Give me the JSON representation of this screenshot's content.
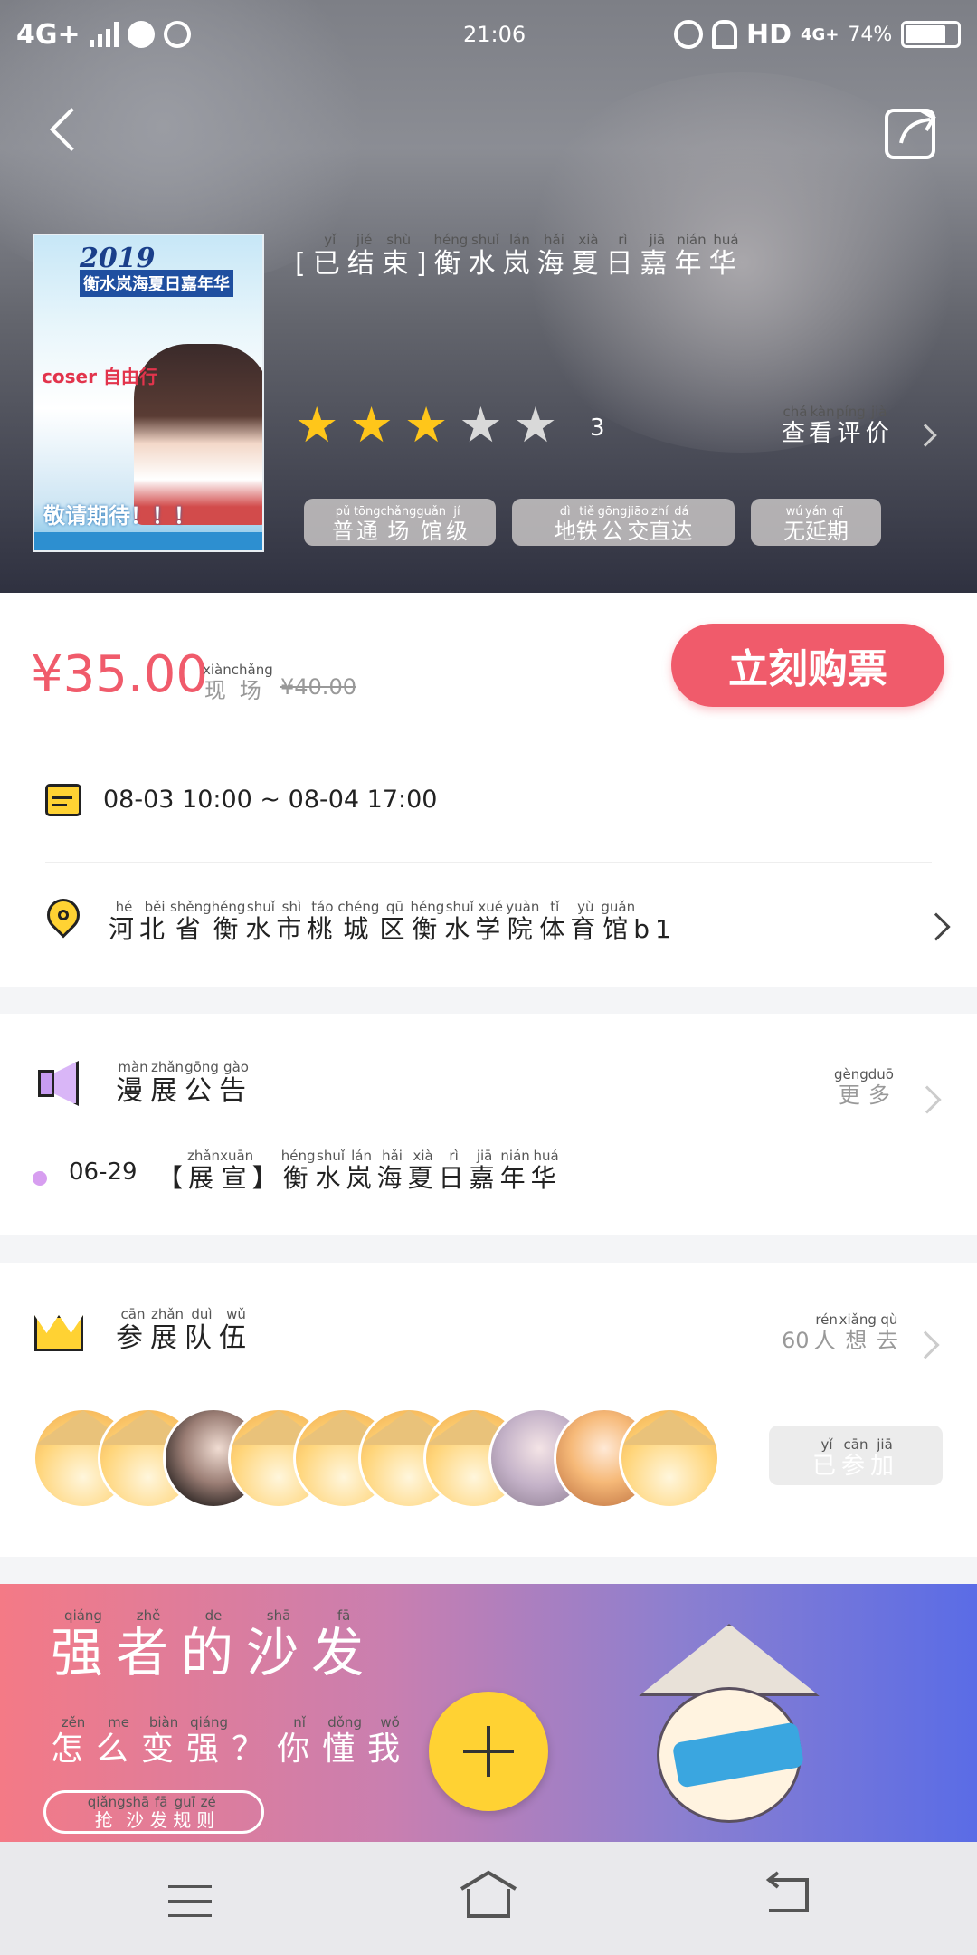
{
  "status_bar": {
    "network": "4G+",
    "time": "21:06",
    "hd": "HD",
    "network2": "4G+",
    "battery": "74%"
  },
  "event": {
    "title_prefix": "[已结束]",
    "title_chars": [
      {
        "c": "已",
        "p": "yǐ"
      },
      {
        "c": "结",
        "p": "jié"
      },
      {
        "c": "束",
        "p": "shù"
      },
      {
        "c": "衡",
        "p": "héng"
      },
      {
        "c": "水",
        "p": "shuǐ"
      },
      {
        "c": "岚",
        "p": "lán"
      },
      {
        "c": "海",
        "p": "hǎi"
      },
      {
        "c": "夏",
        "p": "xià"
      },
      {
        "c": "日",
        "p": "rì"
      },
      {
        "c": "嘉",
        "p": "jiā"
      },
      {
        "c": "年",
        "p": "nián"
      },
      {
        "c": "华",
        "p": "huá"
      }
    ],
    "rating_value": 3,
    "rating_max": 5,
    "rating_text": "3",
    "reviews_link": {
      "chars": [
        {
          "c": "查",
          "p": "chá"
        },
        {
          "c": "看",
          "p": "kàn"
        },
        {
          "c": "评",
          "p": "píng"
        },
        {
          "c": "价",
          "p": "jià"
        }
      ]
    },
    "tags": [
      {
        "chars": [
          {
            "c": "普",
            "p": "pǔ"
          },
          {
            "c": "通",
            "p": "tōng"
          },
          {
            "c": "场",
            "p": "chǎng"
          },
          {
            "c": "馆",
            "p": "guǎn"
          },
          {
            "c": "级",
            "p": "jí"
          }
        ]
      },
      {
        "chars": [
          {
            "c": "地",
            "p": "dì"
          },
          {
            "c": "铁",
            "p": "tiě"
          },
          {
            "c": "公",
            "p": "gōng"
          },
          {
            "c": "交",
            "p": "jiāo"
          },
          {
            "c": "直",
            "p": "zhí"
          },
          {
            "c": "达",
            "p": "dá"
          }
        ]
      },
      {
        "chars": [
          {
            "c": "无",
            "p": "wú"
          },
          {
            "c": "延",
            "p": "yán"
          },
          {
            "c": "期",
            "p": "qī"
          }
        ]
      }
    ],
    "poster": {
      "year": "2019",
      "title": "衡水岚海夏日嘉年华",
      "cos": "coser 自由行",
      "bottom": "敬请期待！！！"
    }
  },
  "pricing": {
    "price": "¥35.00",
    "label_chars": [
      {
        "c": "现",
        "p": "xiàn"
      },
      {
        "c": "场",
        "p": "chǎng"
      }
    ],
    "original_price": "¥40.00",
    "buy_label": "立刻购票",
    "accent": "#f05b6b"
  },
  "schedule": {
    "datetime": "08-03 10:00 ~ 08-04 17:00"
  },
  "location": {
    "chars": [
      {
        "c": "河",
        "p": "hé"
      },
      {
        "c": "北",
        "p": "běi"
      },
      {
        "c": "省",
        "p": "shěng"
      },
      {
        "c": "衡",
        "p": "héng"
      },
      {
        "c": "水",
        "p": "shuǐ"
      },
      {
        "c": "市",
        "p": "shì"
      },
      {
        "c": "桃",
        "p": "táo"
      },
      {
        "c": "城",
        "p": "chéng"
      },
      {
        "c": "区",
        "p": "qū"
      },
      {
        "c": "衡",
        "p": "héng"
      },
      {
        "c": "水",
        "p": "shuǐ"
      },
      {
        "c": "学",
        "p": "xué"
      },
      {
        "c": "院",
        "p": "yuàn"
      },
      {
        "c": "体",
        "p": "tǐ"
      },
      {
        "c": "育",
        "p": "yù"
      },
      {
        "c": "馆",
        "p": "guǎn"
      }
    ],
    "suffix": "b1"
  },
  "announcements": {
    "title_chars": [
      {
        "c": "漫",
        "p": "màn"
      },
      {
        "c": "展",
        "p": "zhǎn"
      },
      {
        "c": "公",
        "p": "gōng"
      },
      {
        "c": "告",
        "p": "gào"
      }
    ],
    "more_chars": [
      {
        "c": "更",
        "p": "gèng"
      },
      {
        "c": "多",
        "p": "duō"
      }
    ],
    "item": {
      "date": "06-29",
      "bracket_chars": [
        {
          "c": "展",
          "p": "zhǎn"
        },
        {
          "c": "宣",
          "p": "xuān"
        }
      ],
      "title_chars": [
        {
          "c": "衡",
          "p": "héng"
        },
        {
          "c": "水",
          "p": "shuǐ"
        },
        {
          "c": "岚",
          "p": "lán"
        },
        {
          "c": "海",
          "p": "hǎi"
        },
        {
          "c": "夏",
          "p": "xià"
        },
        {
          "c": "日",
          "p": "rì"
        },
        {
          "c": "嘉",
          "p": "jiā"
        },
        {
          "c": "年",
          "p": "nián"
        },
        {
          "c": "华",
          "p": "huá"
        }
      ]
    }
  },
  "teams": {
    "title_chars": [
      {
        "c": "参",
        "p": "cān"
      },
      {
        "c": "展",
        "p": "zhǎn"
      },
      {
        "c": "队",
        "p": "duì"
      },
      {
        "c": "伍",
        "p": "wǔ"
      }
    ],
    "count_prefix": "60",
    "count_chars": [
      {
        "c": "人",
        "p": "rén"
      },
      {
        "c": "想",
        "p": "xiǎng"
      },
      {
        "c": "去",
        "p": "qù"
      }
    ],
    "joined_chars": [
      {
        "c": "已",
        "p": "yǐ"
      },
      {
        "c": "参",
        "p": "cān"
      },
      {
        "c": "加",
        "p": "jiā"
      }
    ]
  },
  "banner": {
    "title_chars": [
      {
        "c": "强",
        "p": "qiáng"
      },
      {
        "c": "者",
        "p": "zhě"
      },
      {
        "c": "的",
        "p": "de"
      },
      {
        "c": "沙",
        "p": "shā"
      },
      {
        "c": "发",
        "p": "fā"
      }
    ],
    "subtitle_chars": [
      {
        "c": "怎",
        "p": "zěn"
      },
      {
        "c": "么",
        "p": "me"
      },
      {
        "c": "变",
        "p": "biàn"
      },
      {
        "c": "强",
        "p": "qiáng"
      },
      {
        "c": "？",
        "p": ""
      },
      {
        "c": "你",
        "p": "nǐ"
      },
      {
        "c": "懂",
        "p": "dǒng"
      },
      {
        "c": "我",
        "p": "wǒ"
      }
    ],
    "rules_chars": [
      {
        "c": "抢",
        "p": "qiǎng"
      },
      {
        "c": "沙",
        "p": "shā"
      },
      {
        "c": "发",
        "p": "fā"
      },
      {
        "c": "规",
        "p": "guī"
      },
      {
        "c": "则",
        "p": "zé"
      }
    ],
    "gradient_start": "#f47a86",
    "gradient_end": "#5a6ce6"
  },
  "fab": {
    "icon": "plus-icon",
    "color": "#ffd233"
  },
  "colors": {
    "star_on": "#ffc61a",
    "star_off": "#d9d9d9",
    "dot": "#d79ef0"
  }
}
